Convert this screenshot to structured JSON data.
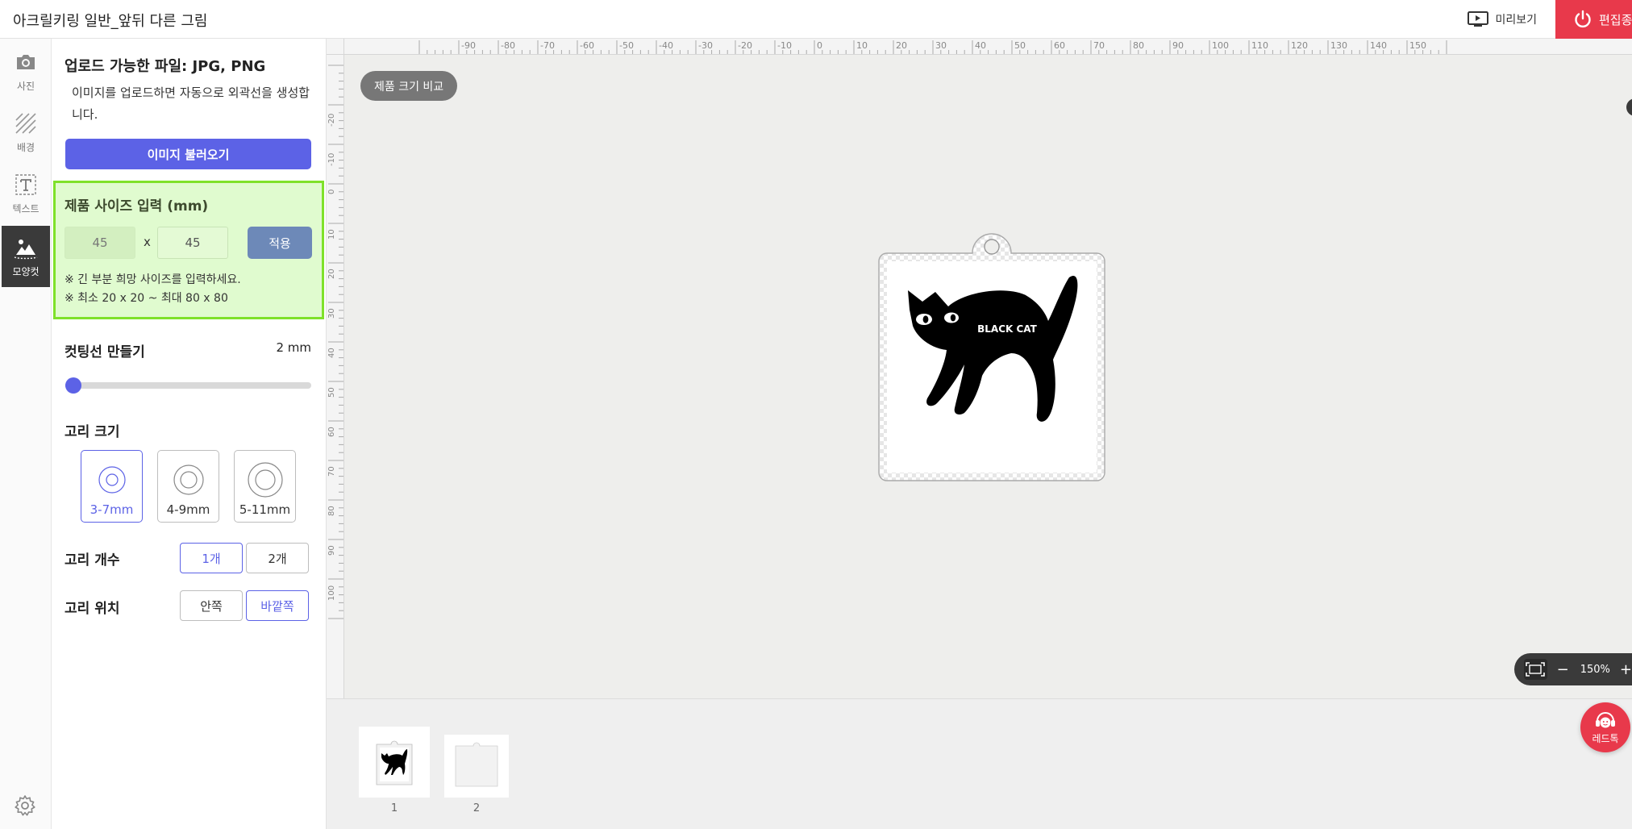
{
  "header": {
    "title": "아크릴키링 일반_앞뒤 다른 그림",
    "preview_label": "미리보기",
    "exit_label": "편집종료",
    "exit_color": "#e8394b"
  },
  "rail": {
    "items": [
      {
        "label": "사진",
        "icon": "camera-icon"
      },
      {
        "label": "배경",
        "icon": "hatch-pattern-icon"
      },
      {
        "label": "텍스트",
        "icon": "text-box-icon"
      },
      {
        "label": "모양컷",
        "icon": "shape-cut-icon"
      }
    ],
    "active": "모양컷",
    "settings_icon": "gear-icon"
  },
  "panel": {
    "upload_title": "업로드 가능한 파일: JPG, PNG",
    "upload_desc": "이미지를 업로드하면 자동으로 외곽선을 생성합니다.",
    "upload_button": "이미지 불러오기",
    "size": {
      "title": "제품 사이즈 입력 (mm)",
      "width": "45",
      "height": "45",
      "separator": "x",
      "apply_label": "적용",
      "note1": "※ 긴 부분 희망 사이즈를 입력하세요.",
      "note2": "※ 최소 20 x 20 ~ 최대 80 x 80"
    },
    "cutline": {
      "title": "컷팅선 만들기",
      "value_label": "2 mm",
      "slider_fraction": 0.0
    },
    "ring_size": {
      "title": "고리 크기",
      "options": [
        "3-7mm",
        "4-9mm",
        "5-11mm"
      ],
      "selected": "3-7mm"
    },
    "ring_count": {
      "title": "고리 개수",
      "options": [
        "1개",
        "2개"
      ],
      "selected": "1개"
    },
    "ring_position": {
      "title": "고리 위치",
      "options": [
        "안쪽",
        "바깥쪽"
      ],
      "selected": "바깥쪽"
    }
  },
  "canvas": {
    "compare_label": "제품 크기 비교",
    "artwork_text": "BLACK CAT",
    "ruler_top_labels": [
      "-90",
      "-80",
      "-70",
      "-60",
      "-50",
      "-40",
      "-30",
      "-20",
      "-10",
      "0",
      "10",
      "20",
      "30",
      "40",
      "50",
      "60",
      "70",
      "80",
      "90",
      "100",
      "110",
      "120",
      "130",
      "140",
      "150"
    ],
    "ruler_left_labels": [
      "-20",
      "-10",
      "0",
      "10",
      "20",
      "30",
      "40",
      "50",
      "60",
      "70",
      "80",
      "90",
      "100"
    ],
    "zoom_label": "150%",
    "zoom_minus": "−",
    "zoom_plus": "+"
  },
  "pages": {
    "items": [
      {
        "number": "1"
      },
      {
        "number": "2"
      }
    ]
  },
  "chat": {
    "label": "레드톡"
  },
  "colors": {
    "accent": "#5c62e6",
    "highlight_fill": "#e0fbcf",
    "highlight_border": "#7fe12a",
    "apply_button": "#6d89b8"
  }
}
